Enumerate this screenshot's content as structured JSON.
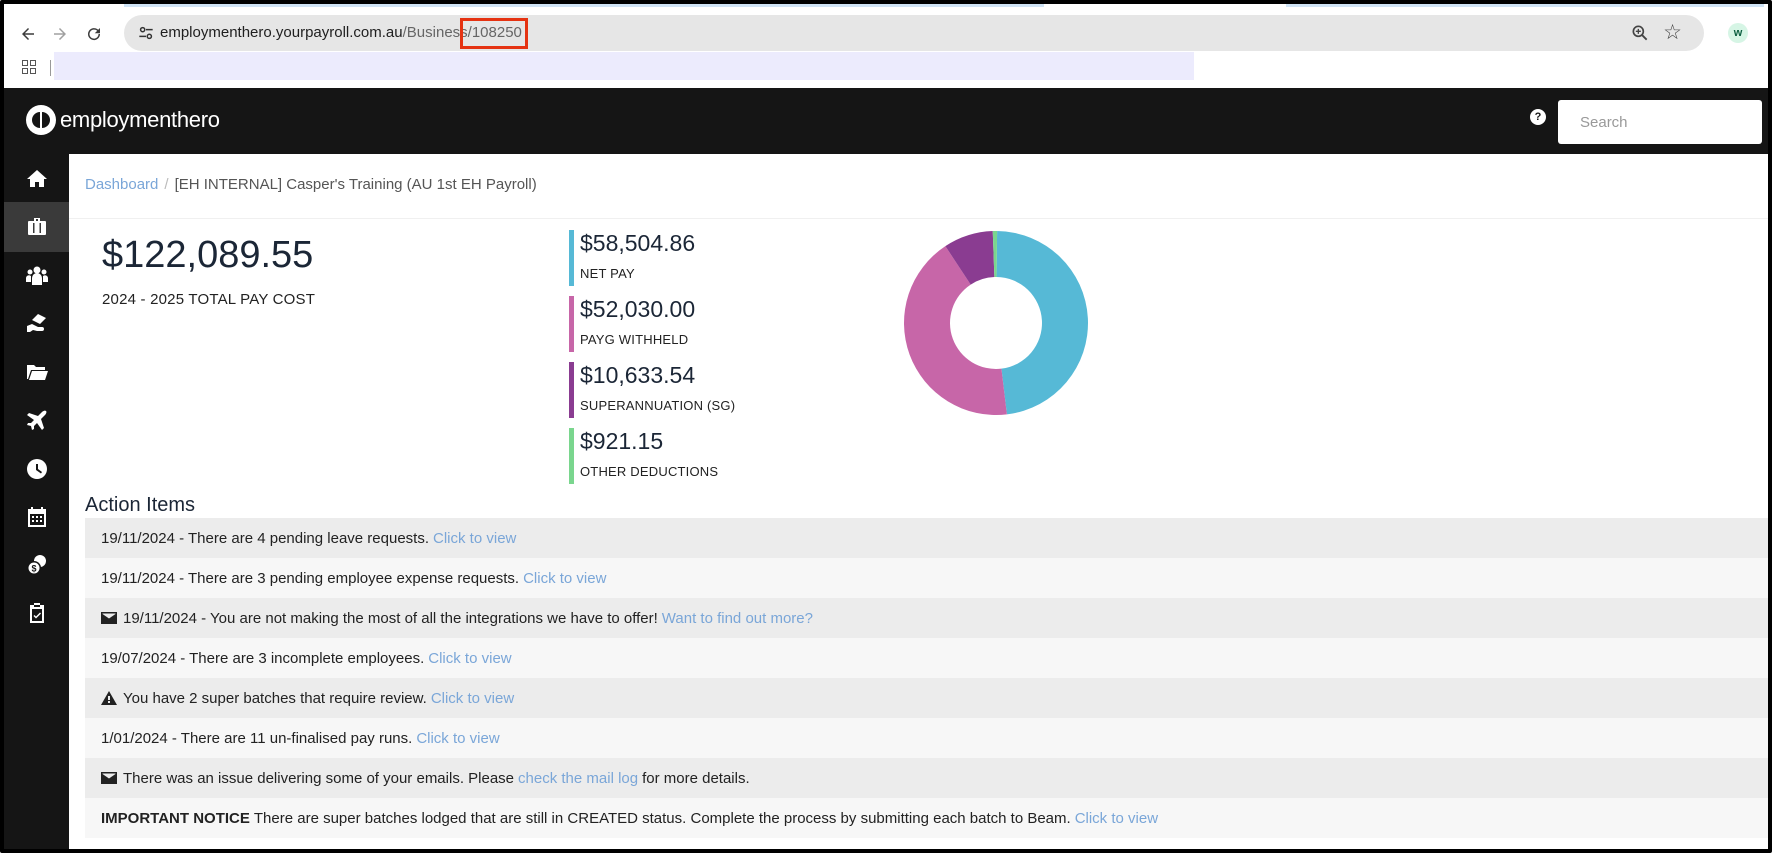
{
  "browser": {
    "url_host": "employmenthero.yourpayroll.com.au",
    "url_path": "/Business",
    "url_id": "/108250",
    "ext_label": "w"
  },
  "header": {
    "logo_text": "employmenthero",
    "help_label": "?",
    "search_placeholder": "Search"
  },
  "sidebar": {
    "items": [
      {
        "icon": "home-icon"
      },
      {
        "icon": "briefcase-icon",
        "active": true
      },
      {
        "icon": "people-icon"
      },
      {
        "icon": "hand-money-icon"
      },
      {
        "icon": "folder-icon"
      },
      {
        "icon": "plane-icon"
      },
      {
        "icon": "clock-icon"
      },
      {
        "icon": "calendar-icon"
      },
      {
        "icon": "coins-icon"
      },
      {
        "icon": "clipboard-icon"
      }
    ]
  },
  "breadcrumb": {
    "root": "Dashboard",
    "separator": "/",
    "current": "[EH INTERNAL] Casper's Training (AU 1st EH Payroll)"
  },
  "summary": {
    "total_amount": "$122,089.55",
    "total_label": "2024 - 2025 TOTAL PAY COST",
    "stats": [
      {
        "amount": "$58,504.86",
        "label": "NET PAY",
        "color": "#56b9d6"
      },
      {
        "amount": "$52,030.00",
        "label": "PAYG WITHHELD",
        "color": "#c766a8"
      },
      {
        "amount": "$10,633.54",
        "label": "SUPERANNUATION (SG)",
        "color": "#8a3c91"
      },
      {
        "amount": "$921.15",
        "label": "OTHER DEDUCTIONS",
        "color": "#7ad68e"
      }
    ]
  },
  "chart_data": {
    "type": "pie",
    "categories": [
      "NET PAY",
      "PAYG WITHHELD",
      "SUPERANNUATION (SG)",
      "OTHER DEDUCTIONS"
    ],
    "values": [
      58504.86,
      52030.0,
      10633.54,
      921.15
    ],
    "colors": [
      "#56b9d6",
      "#c766a8",
      "#8a3c91",
      "#7ad68e"
    ],
    "donut": true
  },
  "actions": {
    "title": "Action Items",
    "items": [
      {
        "text": "19/11/2024 - There are 4 pending leave requests.",
        "link": "Click to view"
      },
      {
        "text": "19/11/2024 - There are 3 pending employee expense requests.",
        "link": "Click to view"
      },
      {
        "icon": "envelope-icon",
        "text": " 19/11/2024 - You are not making the most of all the integrations we have to offer!",
        "link": "Want to find out more?"
      },
      {
        "text": "19/07/2024 - There are 3 incomplete employees.",
        "link": "Click to view"
      },
      {
        "icon": "warning-icon",
        "text": "You have 2 super batches that require review.",
        "link": "Click to view"
      },
      {
        "text": "1/01/2024 - There are 11 un-finalised pay runs.",
        "link": "Click to view"
      },
      {
        "icon": "envelope-icon",
        "text": "There was an issue delivering some of your emails. Please",
        "link": "check the mail log",
        "after": "for more details."
      },
      {
        "strong": "IMPORTANT NOTICE",
        "text": "There are super batches lodged that are still in CREATED status. Complete the process by submitting each batch to Beam.",
        "link": "Click to view"
      }
    ]
  }
}
